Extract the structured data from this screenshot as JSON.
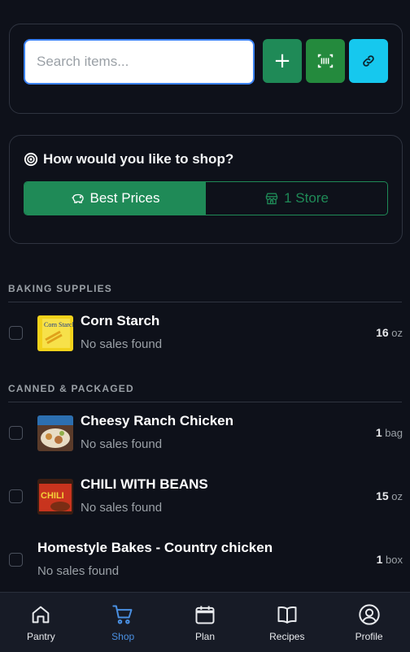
{
  "search": {
    "placeholder": "Search items..."
  },
  "actions": {
    "add": "+"
  },
  "shop_mode": {
    "question": "How would you like to shop?",
    "options": [
      {
        "label": "Best Prices",
        "active": true
      },
      {
        "label": "1 Store",
        "active": false
      }
    ]
  },
  "sections": [
    {
      "title": "BAKING SUPPLIES",
      "items": [
        {
          "name": "Corn Starch",
          "status": "No sales found",
          "qty": "16",
          "unit": "oz",
          "thumb": "corn-starch"
        }
      ]
    },
    {
      "title": "CANNED & PACKAGED",
      "items": [
        {
          "name": "Cheesy Ranch Chicken",
          "status": "No sales found",
          "qty": "1",
          "unit": "bag",
          "thumb": "ranch-chicken"
        },
        {
          "name": "CHILI WITH BEANS",
          "status": "No sales found",
          "qty": "15",
          "unit": "oz",
          "thumb": "chili"
        },
        {
          "name": "Homestyle Bakes - Country chicken",
          "status": "No sales found",
          "qty": "1",
          "unit": "box",
          "thumb": ""
        }
      ]
    }
  ],
  "thumb_text": {
    "corn_starch": "Corn Starch",
    "chili": "CHILI"
  },
  "nav": [
    {
      "label": "Pantry",
      "icon": "home-icon",
      "active": false
    },
    {
      "label": "Shop",
      "icon": "cart-icon",
      "active": true
    },
    {
      "label": "Plan",
      "icon": "calendar-icon",
      "active": false
    },
    {
      "label": "Recipes",
      "icon": "book-icon",
      "active": false
    },
    {
      "label": "Profile",
      "icon": "user-icon",
      "active": false
    }
  ],
  "colors": {
    "background": "#0e111a",
    "accent_green": "#1f8a57",
    "scan_green": "#248a3d",
    "link_cyan": "#16c8ee",
    "active_nav": "#4a90e2"
  }
}
